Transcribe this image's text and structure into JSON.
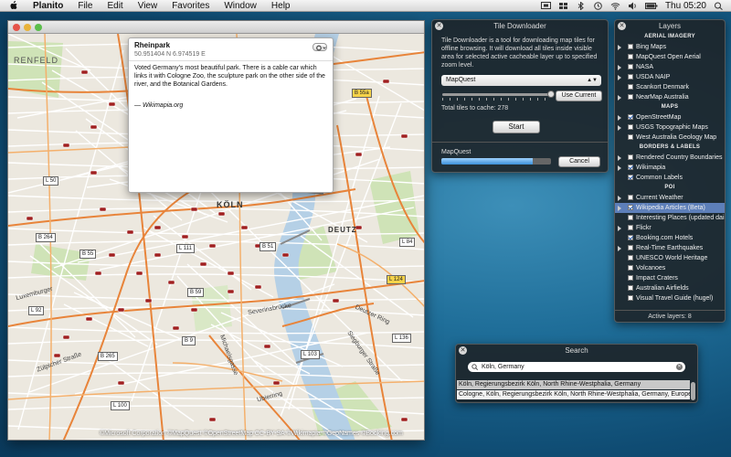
{
  "menubar": {
    "app": "Planito",
    "items": [
      "File",
      "Edit",
      "View",
      "Favorites",
      "Window",
      "Help"
    ],
    "clock": "Thu 05:20"
  },
  "map": {
    "city_label": "KÖLN",
    "district_label": "DEUTZ",
    "area_label": "RENFELD",
    "street_labels": [
      "Zülpicher Straße",
      "Severinsbrücke",
      "Deutzer Ring",
      "Siegburger Straße",
      "Michaelsgasse",
      "Ubierring",
      "Luxemburger"
    ],
    "road_shields": [
      "B 55a",
      "B 55",
      "B 51",
      "B 59",
      "B 265",
      "B 264",
      "B 9",
      "L 50",
      "L 111",
      "L 124",
      "L 100",
      "L 92",
      "L 103",
      "L 84",
      "L 136"
    ],
    "attribution": "©Microsoft Corporation ©MapQuest ©OpenStreetMap CC-BY-SA ©Wikimapia ©GeoNames ©Booking.com"
  },
  "popup": {
    "title": "Rheinpark",
    "coords": "50.951404 N 6.974519 E",
    "description": "Voted Germany's most beautiful park. There is a cable car which links it with Cologne Zoo, the sculpture park on the other side of the river, and the Botanical Gardens.",
    "source": "— Wikimapia.org"
  },
  "tile_downloader": {
    "title": "Tile Downloader",
    "description": "Tile Downloader is a tool for downloading map tiles for offline browsing. It will download all tiles inside visible area for selected active cacheable layer up to specified zoom level.",
    "layer_select": "MapQuest",
    "use_current_label": "Use Current",
    "total_tiles": "Total tiles to cache: 278",
    "start_label": "Start",
    "progress_label": "MapQuest",
    "progress": 0.83,
    "cancel_label": "Cancel"
  },
  "layers": {
    "title": "Layers",
    "sections": [
      {
        "name": "AERIAL IMAGERY",
        "items": [
          {
            "label": "Bing Maps",
            "checked": false,
            "expand": true
          },
          {
            "label": "MapQuest Open Aerial",
            "checked": false,
            "expand": false
          },
          {
            "label": "NASA",
            "checked": false,
            "expand": true
          },
          {
            "label": "USDA NAIP",
            "checked": false,
            "expand": true
          },
          {
            "label": "Scankort Denmark",
            "checked": false,
            "expand": false
          },
          {
            "label": "NearMap Australia",
            "checked": false,
            "expand": true
          }
        ]
      },
      {
        "name": "MAPS",
        "items": [
          {
            "label": "OpenStreetMap",
            "checked": true,
            "expand": true
          },
          {
            "label": "USGS Topographic Maps",
            "checked": false,
            "expand": true
          },
          {
            "label": "West Australia Geology Map",
            "checked": false,
            "expand": false
          }
        ]
      },
      {
        "name": "BORDERS & LABELS",
        "items": [
          {
            "label": "Rendered Country Boundaries",
            "checked": false,
            "expand": true
          },
          {
            "label": "Wikimapia",
            "checked": true,
            "expand": true
          },
          {
            "label": "Common Labels",
            "checked": true,
            "expand": false
          }
        ]
      },
      {
        "name": "POI",
        "items": [
          {
            "label": "Current Weather",
            "checked": false,
            "expand": true
          },
          {
            "label": "Wikipedia Articles (Beta)",
            "checked": true,
            "expand": true,
            "selected": true
          },
          {
            "label": "Interesting Places (updated daily)",
            "checked": false,
            "expand": false
          },
          {
            "label": "Flickr",
            "checked": false,
            "expand": true
          },
          {
            "label": "Booking.com Hotels",
            "checked": true,
            "expand": false
          },
          {
            "label": "Real-Time Earthquakes",
            "checked": false,
            "expand": true
          },
          {
            "label": "UNESCO World Heritage",
            "checked": false,
            "expand": false
          },
          {
            "label": "Volcanoes",
            "checked": false,
            "expand": false
          },
          {
            "label": "Impact Craters",
            "checked": false,
            "expand": false
          },
          {
            "label": "Australian Airfields",
            "checked": false,
            "expand": false
          },
          {
            "label": "Visual Travel Guide (hugel)",
            "checked": false,
            "expand": false
          }
        ]
      }
    ],
    "footer": "Active layers: 8"
  },
  "search": {
    "title": "Search",
    "query": "Köln, Germany",
    "results": [
      "Köln, Regierungsbezirk Köln, North Rhine-Westphalia, Germany",
      "Cologne, Köln, Regierungsbezirk Köln, North Rhine-Westphalia, Germany, Europe"
    ]
  },
  "colors": {
    "desktop": "#1f6e99",
    "hud": "#1e2226",
    "road_major": "#e8843a",
    "river": "#b5d0e6",
    "marker": "#a02020"
  }
}
